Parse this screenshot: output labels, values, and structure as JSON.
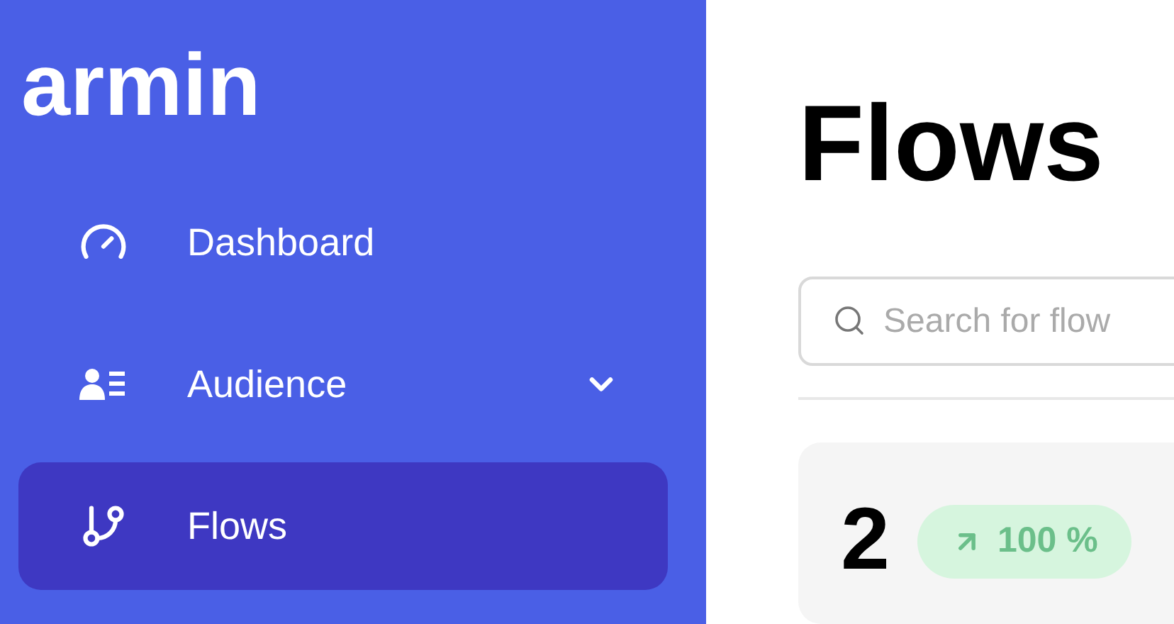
{
  "sidebar": {
    "logo": "armin",
    "items": [
      {
        "label": "Dashboard",
        "kind": "link",
        "selected": false
      },
      {
        "label": "Audience",
        "kind": "group",
        "expanded": false,
        "selected": false
      },
      {
        "label": "Flows",
        "kind": "link",
        "selected": true
      }
    ]
  },
  "main": {
    "title": "Flows",
    "search": {
      "placeholder": "Search for flow"
    },
    "stat_card": {
      "value": "2",
      "change": "100 %"
    }
  }
}
